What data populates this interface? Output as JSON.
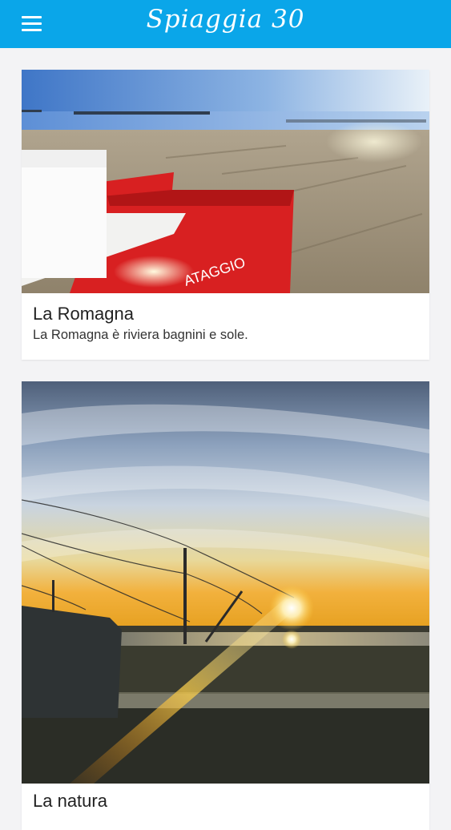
{
  "app": {
    "title": "Spiaggia 30",
    "menu_icon": "hamburger-menu-icon",
    "accent_color": "#0aa6e9",
    "background_color": "#f3f3f5"
  },
  "cards": [
    {
      "title": "La Romagna",
      "description": "La Romagna è riviera bagnini e sole.",
      "image": "beach-with-red-lifeguard-boat"
    },
    {
      "title": "La natura",
      "image": "sunset-over-lagoon-with-fishing-hut"
    }
  ]
}
